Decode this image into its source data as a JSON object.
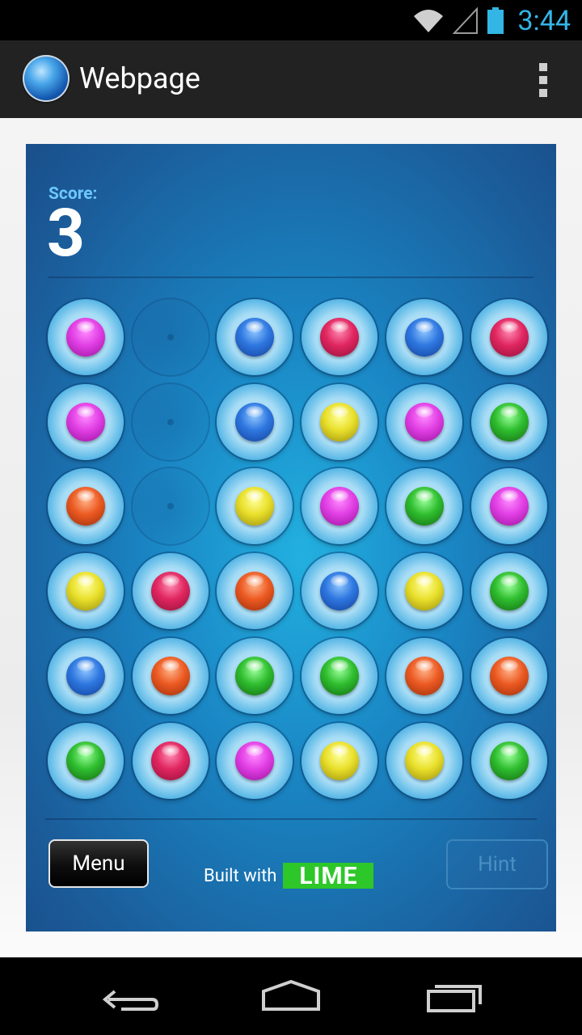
{
  "status_bar": {
    "time": "3:44",
    "icons": [
      "wifi-icon",
      "signal-icon",
      "battery-icon"
    ]
  },
  "action_bar": {
    "title": "Webpage",
    "icon": "globe-app-icon",
    "overflow_icon": "overflow-menu-icon"
  },
  "game": {
    "score_label": "Score:",
    "score_value": "3",
    "board": [
      [
        "magenta",
        "empty",
        "blue",
        "red",
        "blue",
        "red"
      ],
      [
        "magenta",
        "empty",
        "blue",
        "yellow",
        "magenta",
        "green"
      ],
      [
        "orange",
        "empty",
        "yellow",
        "magenta",
        "green",
        "magenta"
      ],
      [
        "yellow",
        "red",
        "orange",
        "blue",
        "yellow",
        "green"
      ],
      [
        "blue",
        "orange",
        "green",
        "green",
        "orange",
        "orange"
      ],
      [
        "green",
        "red",
        "magenta",
        "yellow",
        "yellow",
        "green"
      ]
    ],
    "menu_label": "Menu",
    "built_with_label": "Built with",
    "lime_label": "LIME",
    "hint_label": "Hint"
  },
  "nav_bar": {
    "icons": [
      "back-icon",
      "home-icon",
      "recent-apps-icon"
    ]
  }
}
